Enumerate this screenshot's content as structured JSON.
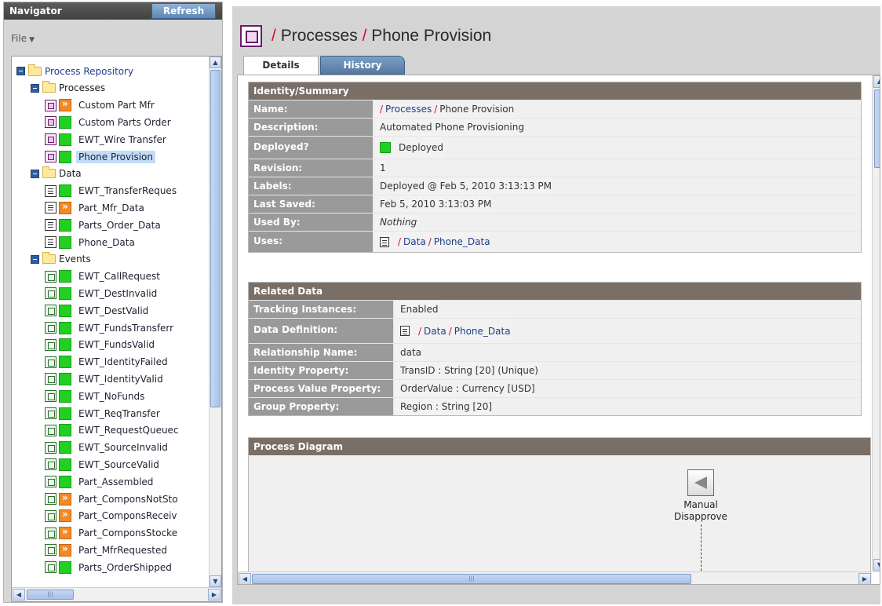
{
  "navigator": {
    "title": "Navigator",
    "refresh_label": "Refresh",
    "file_menu_label": "File",
    "tree": {
      "root_label": "Process Repository",
      "processes_label": "Processes",
      "processes": [
        {
          "label": "Custom Part Mfr",
          "status": "orange"
        },
        {
          "label": "Custom Parts Order",
          "status": "green"
        },
        {
          "label": "EWT_Wire Transfer",
          "status": "green"
        },
        {
          "label": "Phone Provision",
          "status": "green",
          "selected": true
        }
      ],
      "data_label": "Data",
      "data": [
        {
          "label": "EWT_TransferReques",
          "status": "green"
        },
        {
          "label": "Part_Mfr_Data",
          "status": "orange"
        },
        {
          "label": "Parts_Order_Data",
          "status": "green"
        },
        {
          "label": "Phone_Data",
          "status": "green"
        }
      ],
      "events_label": "Events",
      "events": [
        {
          "label": "EWT_CallRequest",
          "status": "green"
        },
        {
          "label": "EWT_DestInvalid",
          "status": "green"
        },
        {
          "label": "EWT_DestValid",
          "status": "green"
        },
        {
          "label": "EWT_FundsTransferr",
          "status": "green"
        },
        {
          "label": "EWT_FundsValid",
          "status": "green"
        },
        {
          "label": "EWT_IdentityFailed",
          "status": "green"
        },
        {
          "label": "EWT_IdentityValid",
          "status": "green"
        },
        {
          "label": "EWT_NoFunds",
          "status": "green"
        },
        {
          "label": "EWT_ReqTransfer",
          "status": "green"
        },
        {
          "label": "EWT_RequestQueuec",
          "status": "green"
        },
        {
          "label": "EWT_SourceInvalid",
          "status": "green"
        },
        {
          "label": "EWT_SourceValid",
          "status": "green"
        },
        {
          "label": "Part_Assembled",
          "status": "green"
        },
        {
          "label": "Part_ComponsNotSto",
          "status": "orange"
        },
        {
          "label": "Part_ComponsReceiv",
          "status": "orange"
        },
        {
          "label": "Part_ComponsStocke",
          "status": "orange"
        },
        {
          "label": "Part_MfrRequested",
          "status": "orange"
        },
        {
          "label": "Parts_OrderShipped",
          "status": "green"
        }
      ]
    }
  },
  "header": {
    "sep": "/",
    "crumb1": "Processes",
    "crumb2": "Phone Provision"
  },
  "tabs": {
    "details": "Details",
    "history": "History"
  },
  "identity": {
    "title": "Identity/Summary",
    "name_label": "Name:",
    "name_sep": "/",
    "name_crumb1": "Processes",
    "name_crumb2": "Phone Provision",
    "description_label": "Description:",
    "description_value": "Automated Phone Provisioning",
    "deployed_label": "Deployed?",
    "deployed_value": "Deployed",
    "revision_label": "Revision:",
    "revision_value": "1",
    "labels_label": "Labels:",
    "labels_value": "Deployed @ Feb 5, 2010 3:13:13 PM",
    "last_saved_label": "Last Saved:",
    "last_saved_value": "Feb 5, 2010 3:13:03 PM",
    "used_by_label": "Used By:",
    "used_by_value": "Nothing",
    "uses_label": "Uses:",
    "uses_sep": "/",
    "uses_crumb1": "Data",
    "uses_crumb2": "Phone_Data"
  },
  "related": {
    "title": "Related Data",
    "tracking_label": "Tracking Instances:",
    "tracking_value": "Enabled",
    "datadef_label": "Data Definition:",
    "datadef_sep": "/",
    "datadef_crumb1": "Data",
    "datadef_crumb2": "Phone_Data",
    "relname_label": "Relationship Name:",
    "relname_value": "data",
    "identity_label": "Identity Property:",
    "identity_value": "TransID : String [20] (Unique)",
    "pvalue_label": "Process Value Property:",
    "pvalue_value": "OrderValue : Currency [USD]",
    "group_label": "Group Property:",
    "group_value": "Region : String [20]"
  },
  "diagram": {
    "title": "Process Diagram",
    "node_line1": "Manual",
    "node_line2": "Disapprove"
  },
  "icons": {
    "process": "process-icon",
    "data": "data-document-icon",
    "event": "event-icon",
    "expand": "collapse-minus-icon",
    "folder": "folder-icon"
  },
  "colors": {
    "status_green": "#22d022",
    "status_orange": "#f08a24",
    "section_header": "#7a6f66",
    "label_cell": "#9a9a9a",
    "breadcrumb_sep": "#c8102e",
    "tab_active": "#ffffff",
    "tab_inactive": "#6a8fba"
  }
}
